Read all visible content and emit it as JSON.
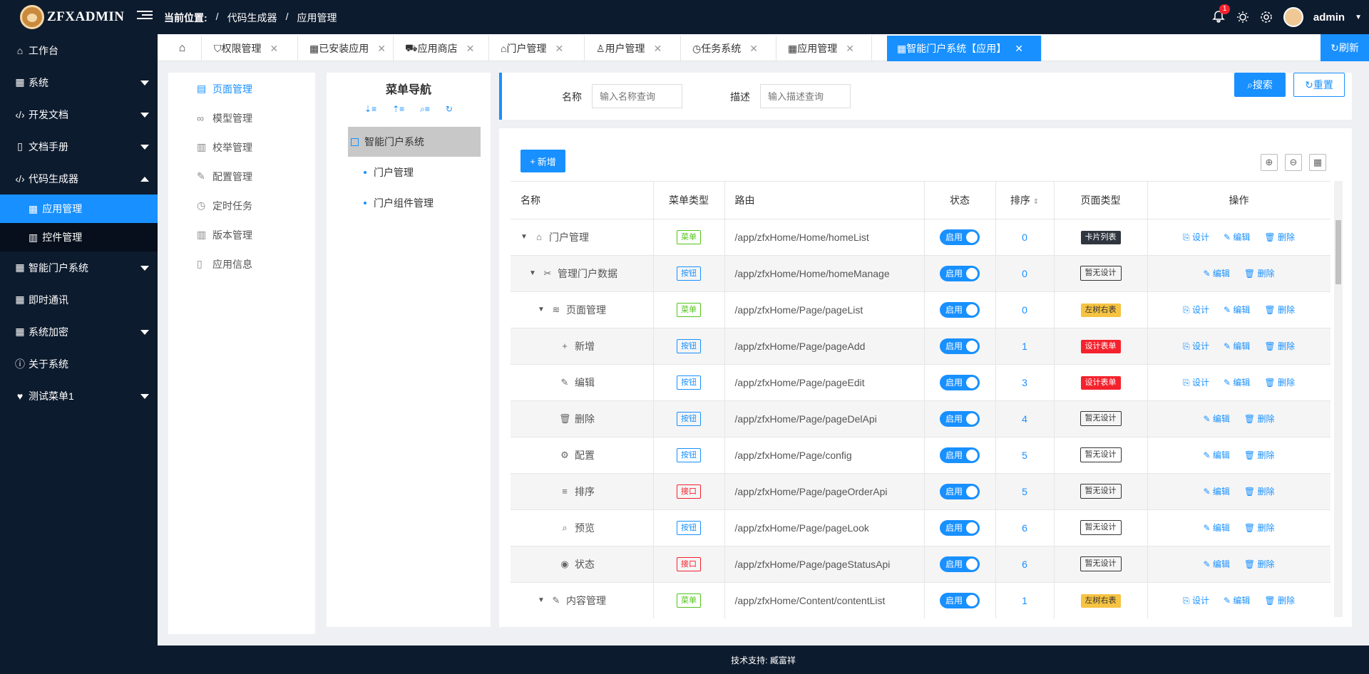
{
  "brand": {
    "name": "ZFXADMIN"
  },
  "breadcrumb": {
    "label": "当前位置:",
    "items": [
      "/",
      "代码生成器",
      "/",
      "应用管理"
    ]
  },
  "header": {
    "notification_count": "1",
    "user": "admin"
  },
  "sidebar": {
    "items": [
      {
        "label": "工作台"
      },
      {
        "label": "系统"
      },
      {
        "label": "开发文档"
      },
      {
        "label": "文档手册"
      },
      {
        "label": "代码生成器"
      },
      {
        "label": "智能门户系统"
      },
      {
        "label": "即时通讯"
      },
      {
        "label": "系统加密"
      },
      {
        "label": "关于系统"
      },
      {
        "label": "测试菜单1"
      }
    ],
    "sub_items": [
      {
        "label": "应用管理"
      },
      {
        "label": "控件管理"
      }
    ]
  },
  "tabs": [
    {
      "label": ""
    },
    {
      "label": "权限管理"
    },
    {
      "label": "已安装应用"
    },
    {
      "label": "应用商店"
    },
    {
      "label": "门户管理"
    },
    {
      "label": "用户管理"
    },
    {
      "label": "任务系统"
    },
    {
      "label": "应用管理"
    },
    {
      "label": "智能门户系统【应用】"
    }
  ],
  "refresh_label": "刷新",
  "app_menu": [
    {
      "label": "页面管理"
    },
    {
      "label": "模型管理"
    },
    {
      "label": "校举管理"
    },
    {
      "label": "配置管理"
    },
    {
      "label": "定时任务"
    },
    {
      "label": "版本管理"
    },
    {
      "label": "应用信息"
    }
  ],
  "nav": {
    "title": "菜单导航",
    "root": "智能门户系统",
    "children": [
      {
        "label": "门户管理"
      },
      {
        "label": "门户组件管理"
      }
    ]
  },
  "search": {
    "name_label": "名称",
    "name_placeholder": "输入名称查询",
    "desc_label": "描述",
    "desc_placeholder": "输入描述查询",
    "search_btn": "搜索",
    "reset_btn": "重置"
  },
  "table": {
    "add_btn": "新增",
    "headers": [
      "名称",
      "菜单类型",
      "路由",
      "状态",
      "排序",
      "页面类型",
      "操作"
    ],
    "ops": {
      "design": "设计",
      "edit": "编辑",
      "delete": "删除"
    },
    "rows": [
      {
        "name": "门户管理",
        "type": "菜单",
        "route": "/app/zfxHome/Home/homeList",
        "status": "启用",
        "order": "0",
        "page": "卡片列表"
      },
      {
        "name": "管理门户数据",
        "type": "按钮",
        "route": "/app/zfxHome/Home/homeManage",
        "status": "启用",
        "order": "0",
        "page": "暂无设计"
      },
      {
        "name": "页面管理",
        "type": "菜单",
        "route": "/app/zfxHome/Page/pageList",
        "status": "启用",
        "order": "0",
        "page": "左树右表"
      },
      {
        "name": "新增",
        "type": "按钮",
        "route": "/app/zfxHome/Page/pageAdd",
        "status": "启用",
        "order": "1",
        "page": "设计表单"
      },
      {
        "name": "编辑",
        "type": "按钮",
        "route": "/app/zfxHome/Page/pageEdit",
        "status": "启用",
        "order": "3",
        "page": "设计表单"
      },
      {
        "name": "删除",
        "type": "按钮",
        "route": "/app/zfxHome/Page/pageDelApi",
        "status": "启用",
        "order": "4",
        "page": "暂无设计"
      },
      {
        "name": "配置",
        "type": "按钮",
        "route": "/app/zfxHome/Page/config",
        "status": "启用",
        "order": "5",
        "page": "暂无设计"
      },
      {
        "name": "排序",
        "type": "接口",
        "route": "/app/zfxHome/Page/pageOrderApi",
        "status": "启用",
        "order": "5",
        "page": "暂无设计"
      },
      {
        "name": "预览",
        "type": "按钮",
        "route": "/app/zfxHome/Page/pageLook",
        "status": "启用",
        "order": "6",
        "page": "暂无设计"
      },
      {
        "name": "状态",
        "type": "接口",
        "route": "/app/zfxHome/Page/pageStatusApi",
        "status": "启用",
        "order": "6",
        "page": "暂无设计"
      },
      {
        "name": "内容管理",
        "type": "菜单",
        "route": "/app/zfxHome/Content/contentList",
        "status": "启用",
        "order": "1",
        "page": "左树右表"
      }
    ]
  },
  "footer": {
    "text": "技术支持: 臧富祥"
  }
}
